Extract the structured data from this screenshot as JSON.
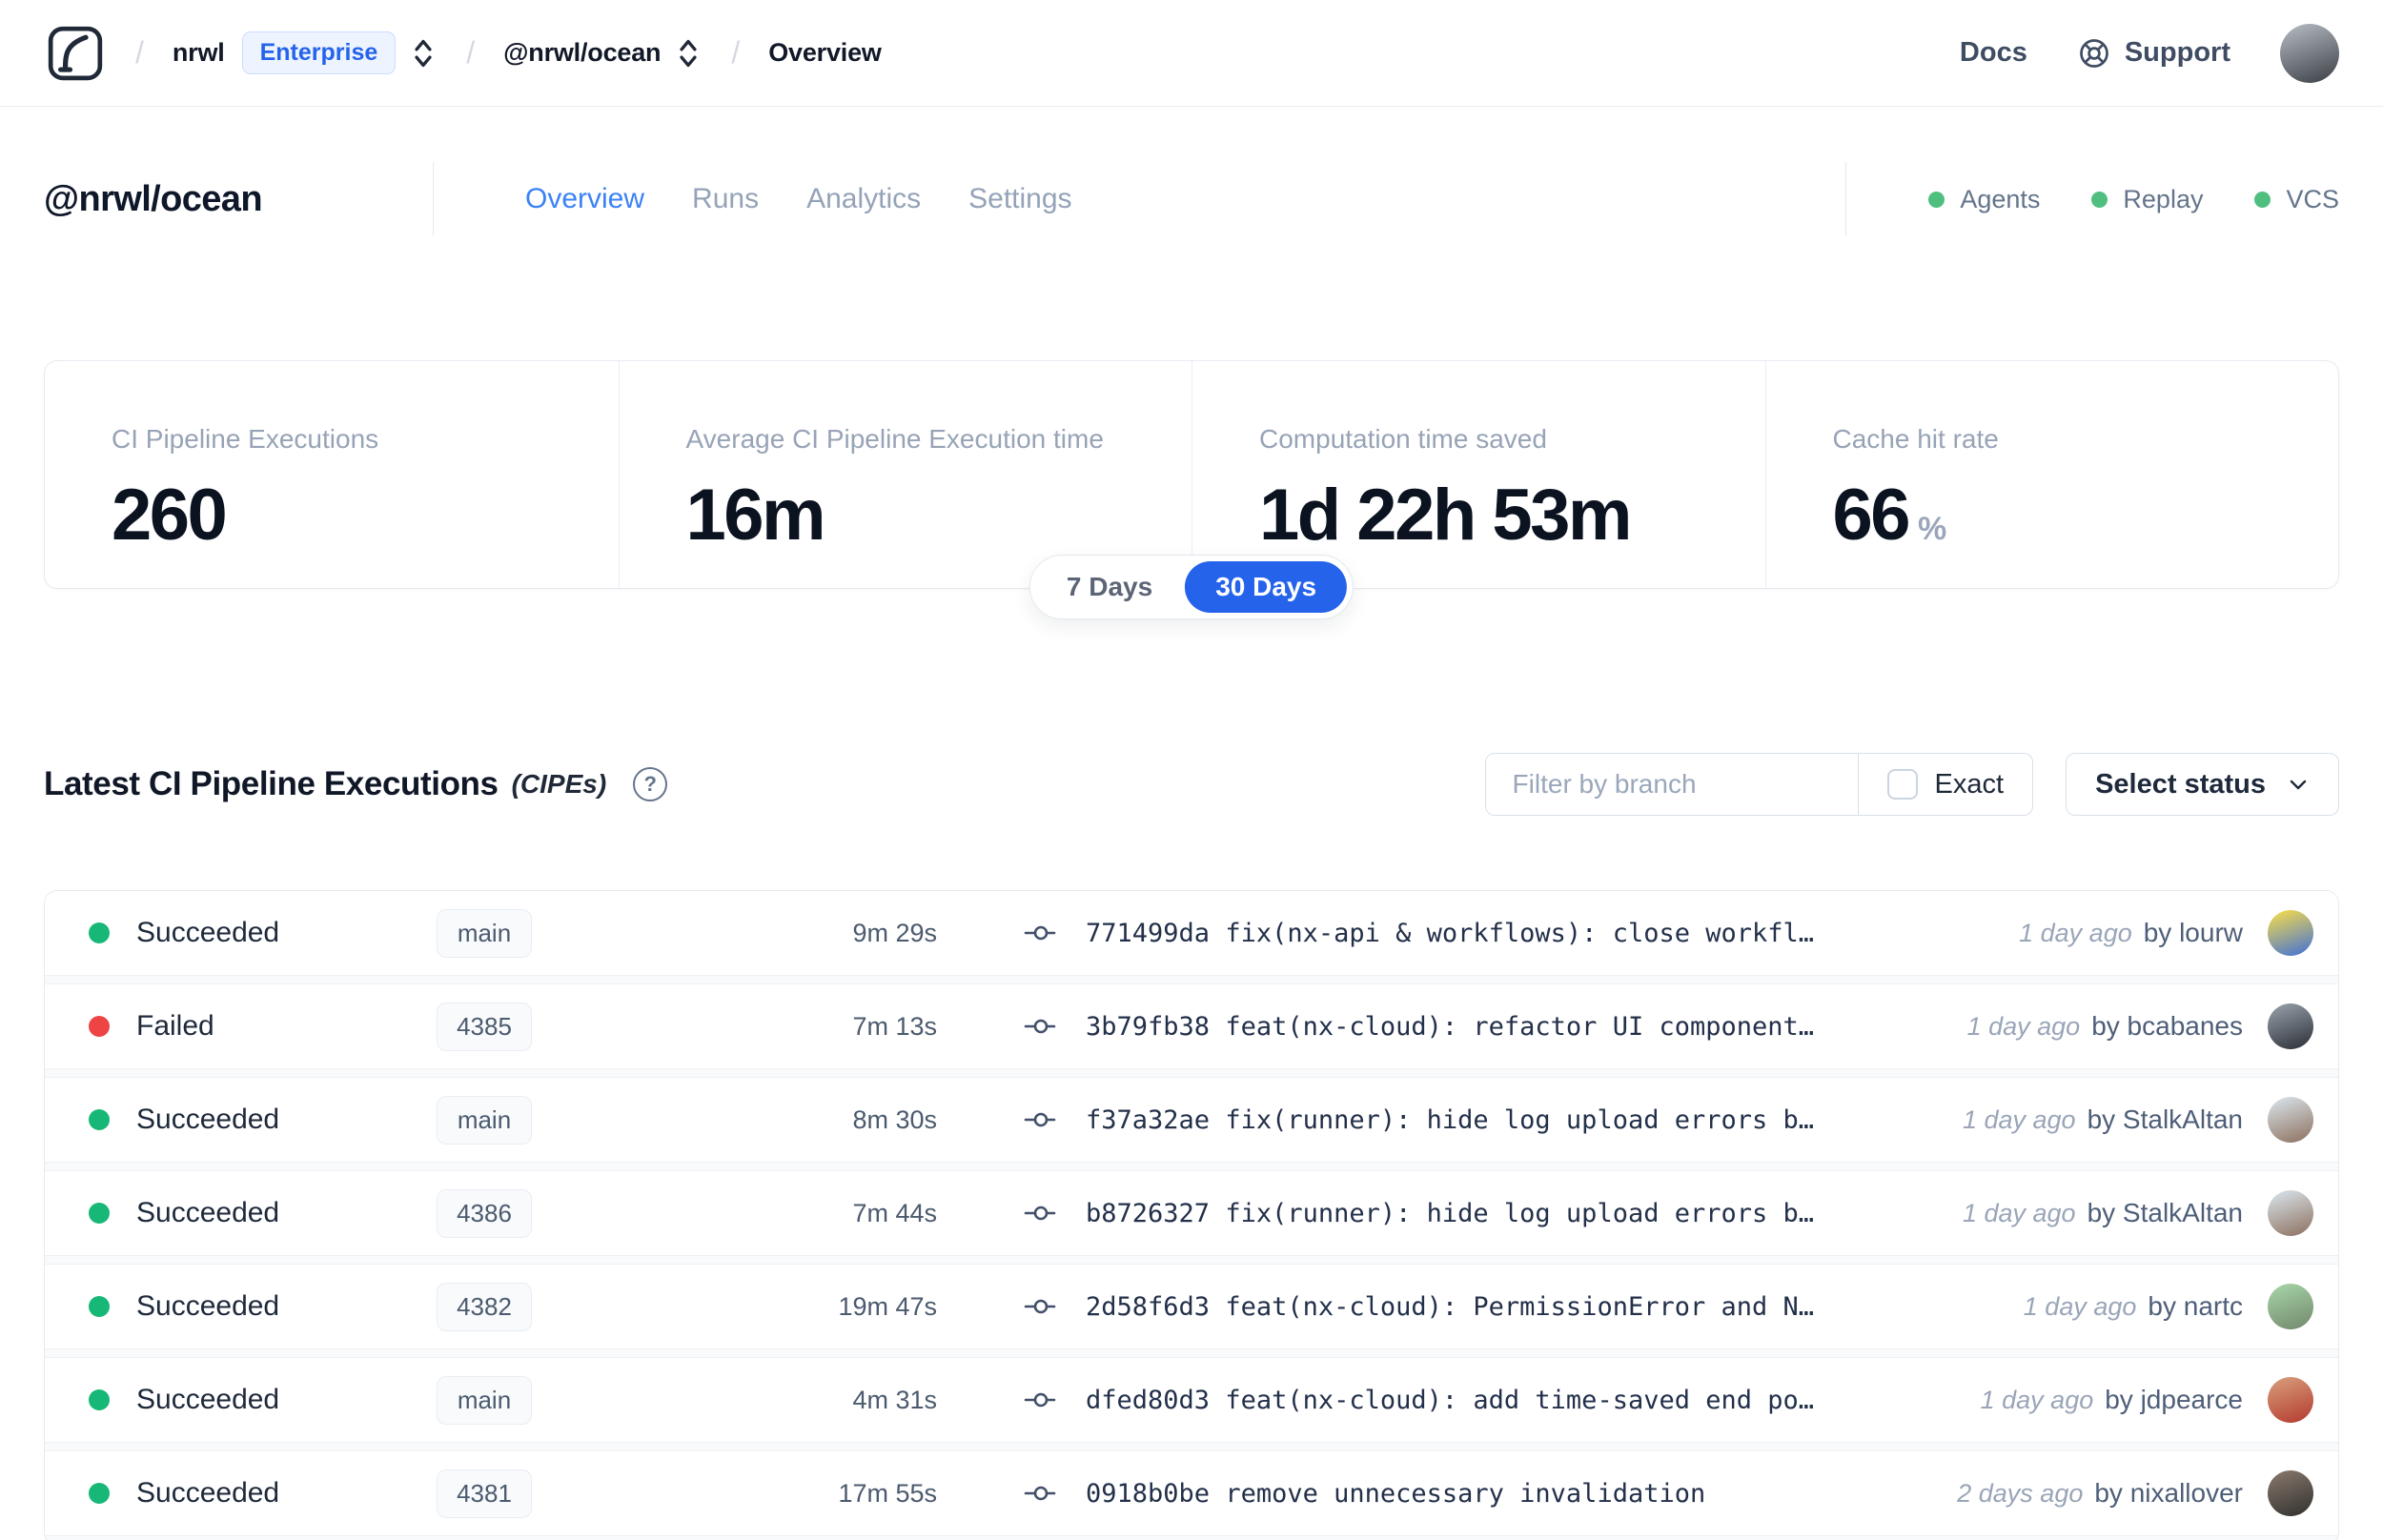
{
  "topbar": {
    "breadcrumb": {
      "org": "nrwl",
      "plan_badge": "Enterprise",
      "workspace": "@nrwl/ocean",
      "page": "Overview"
    },
    "docs_label": "Docs",
    "support_label": "Support"
  },
  "workspace": {
    "title": "@nrwl/ocean",
    "tabs": [
      {
        "label": "Overview",
        "active": true
      },
      {
        "label": "Runs",
        "active": false
      },
      {
        "label": "Analytics",
        "active": false
      },
      {
        "label": "Settings",
        "active": false
      }
    ],
    "services": [
      "Agents",
      "Replay",
      "VCS"
    ]
  },
  "stats": {
    "cards": [
      {
        "label": "CI Pipeline Executions",
        "value": "260",
        "suffix": ""
      },
      {
        "label": "Average CI Pipeline Execution time",
        "value": "16m",
        "suffix": ""
      },
      {
        "label": "Computation time saved",
        "value": "1d 22h 53m",
        "suffix": ""
      },
      {
        "label": "Cache hit rate",
        "value": "66",
        "suffix": "%"
      }
    ],
    "period_options": [
      "7 Days",
      "30 Days"
    ],
    "selected_period": "30 Days"
  },
  "cipes": {
    "title": "Latest CI Pipeline Executions",
    "title_suffix": "(CIPEs)",
    "help_glyph": "?",
    "filter_placeholder": "Filter by branch",
    "exact_label": "Exact",
    "exact_checked": false,
    "status_select_label": "Select status",
    "rows": [
      {
        "status": "Succeeded",
        "branch": "main",
        "duration": "9m 29s",
        "commit_hash": "771499da",
        "commit_message": "fix(nx-api & workflows): close workfl…",
        "time": "1 day ago",
        "author": "by lourw",
        "avatar_colors": [
          "#fde047",
          "#3f6fd8"
        ]
      },
      {
        "status": "Failed",
        "branch": "4385",
        "duration": "7m 13s",
        "commit_hash": "3b79fb38",
        "commit_message": "feat(nx-cloud): refactor UI component…",
        "time": "1 day ago",
        "author": "by bcabanes",
        "avatar_colors": [
          "#9aa3ad",
          "#2b2f36"
        ]
      },
      {
        "status": "Succeeded",
        "branch": "main",
        "duration": "8m 30s",
        "commit_hash": "f37a32ae",
        "commit_message": "fix(runner): hide log upload errors b…",
        "time": "1 day ago",
        "author": "by StalkAltan",
        "avatar_colors": [
          "#dce8f0",
          "#8c6f5d"
        ]
      },
      {
        "status": "Succeeded",
        "branch": "4386",
        "duration": "7m 44s",
        "commit_hash": "b8726327",
        "commit_message": "fix(runner): hide log upload errors b…",
        "time": "1 day ago",
        "author": "by StalkAltan",
        "avatar_colors": [
          "#dce8f0",
          "#8c6f5d"
        ]
      },
      {
        "status": "Succeeded",
        "branch": "4382",
        "duration": "19m 47s",
        "commit_hash": "2d58f6d3",
        "commit_message": "feat(nx-cloud): PermissionError and N…",
        "time": "1 day ago",
        "author": "by nartc",
        "avatar_colors": [
          "#a8d7a9",
          "#72876b"
        ]
      },
      {
        "status": "Succeeded",
        "branch": "main",
        "duration": "4m 31s",
        "commit_hash": "dfed80d3",
        "commit_message": "feat(nx-cloud): add time-saved end po…",
        "time": "1 day ago",
        "author": "by jdpearce",
        "avatar_colors": [
          "#d9a07e",
          "#b33a2e"
        ]
      },
      {
        "status": "Succeeded",
        "branch": "4381",
        "duration": "17m 55s",
        "commit_hash": "0918b0be",
        "commit_message": "remove unnecessary invalidation",
        "time": "2 days ago",
        "author": "by nixallover",
        "avatar_colors": [
          "#8a7a6e",
          "#31302e"
        ]
      }
    ]
  },
  "colors": {
    "succeeded": "#17b877",
    "failed": "#ee4444",
    "service_dot": "#4fbf7f",
    "accent_blue": "#2563eb",
    "active_tab_blue": "#3b82f6",
    "topbar_avatar": [
      "#b9bec6",
      "#3a3f45"
    ]
  }
}
